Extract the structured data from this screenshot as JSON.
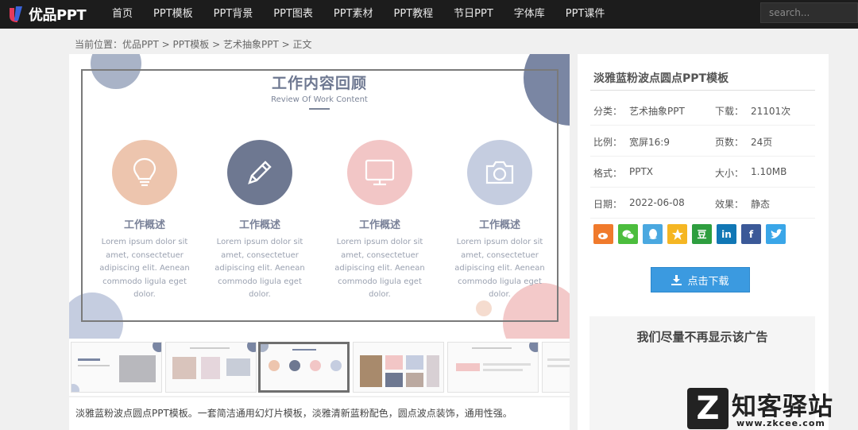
{
  "nav": {
    "logo_text": "优品PPT",
    "items": [
      "首页",
      "PPT模板",
      "PPT背景",
      "PPT图表",
      "PPT素材",
      "PPT教程",
      "节日PPT",
      "字体库",
      "PPT课件"
    ],
    "search_placeholder": "search..."
  },
  "breadcrumb": "当前位置：优品PPT > PPT模板 > 艺术抽象PPT > 正文",
  "slide": {
    "title": "工作内容回顾",
    "subtitle": "Review Of Work Content",
    "features": [
      {
        "icon": "lightbulb-icon",
        "title": "工作概述",
        "text": "Lorem ipsum dolor sit amet, consectetuer adipiscing elit. Aenean commodo ligula eget dolor.",
        "color": "#edc5ae"
      },
      {
        "icon": "pencil-icon",
        "title": "工作概述",
        "text": "Lorem ipsum dolor sit amet, consectetuer adipiscing elit. Aenean commodo ligula eget dolor.",
        "color": "#6e7891"
      },
      {
        "icon": "monitor-icon",
        "title": "工作概述",
        "text": "Lorem ipsum dolor sit amet, consectetuer adipiscing elit. Aenean commodo ligula eget dolor.",
        "color": "#f2c6c6"
      },
      {
        "icon": "camera-icon",
        "title": "工作概述",
        "text": "Lorem ipsum dolor sit amet, consectetuer adipiscing elit. Aenean commodo ligula eget dolor.",
        "color": "#c5cde0"
      }
    ]
  },
  "description": "淡雅蓝粉波点圆点PPT模板。一套简洁通用幻灯片模板，淡雅清新蓝粉配色，圆点波点装饰，通用性强。",
  "info": {
    "title": "淡雅蓝粉波点圆点PPT模板",
    "rows": [
      {
        "k1": "分类：",
        "v1": "艺术抽象PPT",
        "k2": "下载：",
        "v2": "21101次"
      },
      {
        "k1": "比例：",
        "v1": "宽屏16:9",
        "k2": "页数：",
        "v2": "24页"
      },
      {
        "k1": "格式：",
        "v1": "PPTX",
        "k2": "大小：",
        "v2": "1.10MB"
      },
      {
        "k1": "日期：",
        "v1": "2022-06-08",
        "k2": "效果：",
        "v2": "静态"
      }
    ],
    "download_label": "点击下载",
    "ad_text": "我们尽量不再显示该广告"
  },
  "shares": [
    {
      "name": "weibo-icon",
      "color": "#f07a2c"
    },
    {
      "name": "wechat-icon",
      "color": "#4cbd3d"
    },
    {
      "name": "qq-icon",
      "color": "#4aa8e0"
    },
    {
      "name": "qzone-icon",
      "color": "#f5b623"
    },
    {
      "name": "douban-icon",
      "color": "#2e9e3f",
      "label": "豆"
    },
    {
      "name": "linkedin-icon",
      "color": "#1177b5",
      "label": "in"
    },
    {
      "name": "facebook-icon",
      "color": "#3b5998",
      "label": "f"
    },
    {
      "name": "twitter-icon",
      "color": "#3aa6e8"
    }
  ],
  "watermark": {
    "letter": "Z",
    "text": "知客驿站",
    "url": "www.zkcee.com"
  },
  "colors": {
    "accent": "#3b9ae0",
    "slate": "#6e7891",
    "pink": "#f2c6c6",
    "peach": "#edc5ae",
    "blue_gray": "#c5cde0"
  }
}
